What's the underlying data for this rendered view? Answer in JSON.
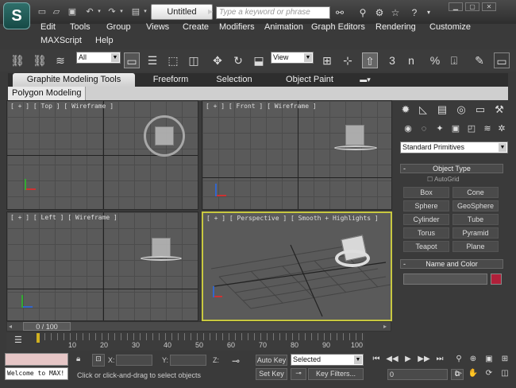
{
  "window": {
    "title": "Untitled",
    "search_placeholder": "Type a keyword or phrase",
    "logo": "S"
  },
  "menu": [
    "Edit",
    "Tools",
    "Group",
    "Views",
    "Create",
    "Modifiers",
    "Animation",
    "Graph Editors",
    "Rendering",
    "Customize",
    "MAXScript",
    "Help"
  ],
  "toolbar": {
    "selection_filter": "All",
    "ref_coord": "View",
    "snap_3": "3",
    "snap_angle": "n",
    "snap_percent": "%"
  },
  "ribbon": {
    "tabs": [
      "Graphite Modeling Tools",
      "Freeform",
      "Selection",
      "Object Paint"
    ],
    "sub_tab": "Polygon Modeling"
  },
  "viewports": [
    {
      "label": "[ + ] [ Top ] [ Wireframe ]"
    },
    {
      "label": "[ + ] [ Front ] [ Wireframe ]"
    },
    {
      "label": "[ + ] [ Left ] [ Wireframe ]"
    },
    {
      "label": "[ + ] [ Perspective ] [ Smooth + Highlights ]"
    }
  ],
  "command_panel": {
    "category_dropdown": "Standard Primitives",
    "rollout_object_type": "Object Type",
    "autogrid_label": "AutoGrid",
    "object_types": [
      "Box",
      "Cone",
      "Sphere",
      "GeoSphere",
      "Cylinder",
      "Tube",
      "Torus",
      "Pyramid",
      "Teapot",
      "Plane"
    ],
    "rollout_name_color": "Name and Color",
    "object_color": "#b0203a"
  },
  "timeline": {
    "frame_display": "0 / 100",
    "ticks": [
      "10",
      "20",
      "30",
      "40",
      "50",
      "60",
      "70",
      "80",
      "90",
      "100"
    ]
  },
  "status": {
    "maxscript_output": "Welcome to MAX!",
    "x_label": "X:",
    "y_label": "Y:",
    "z_label": "Z:",
    "prompt": "Click or click-and-drag to select objects",
    "auto_key": "Auto Key",
    "set_key": "Set Key",
    "key_mode": "Selected",
    "key_filters": "Key Filters...",
    "current_frame": "0"
  },
  "colors": {
    "active_viewport_border": "#c8c840",
    "watermark_text": "#e03a3a"
  }
}
